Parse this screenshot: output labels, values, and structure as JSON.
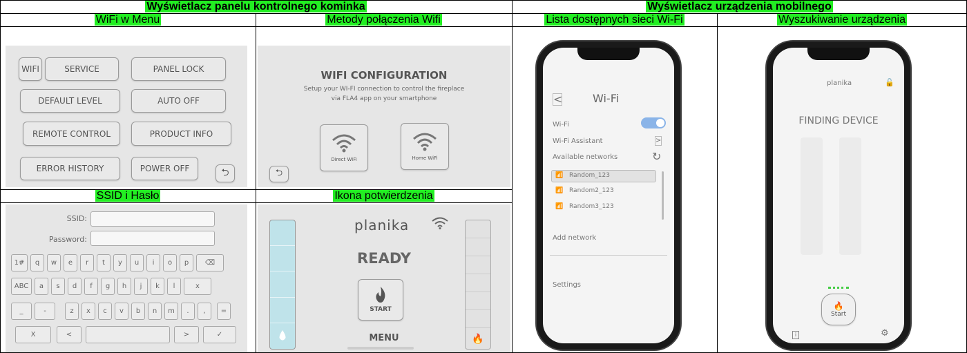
{
  "headers": {
    "left_title": "Wyświetlacz panelu kontrolnego kominka",
    "right_title": "Wyświetlacz urządzenia mobilnego",
    "wifi_menu": "WiFi w Menu",
    "methods": "Metody połączenia Wifi",
    "networks_list": "Lista dostępnych sieci Wi-Fi",
    "finding": "Wyszukiwanie urządzenia",
    "ssid_pass": "SSID i Hasło",
    "confirm_icon": "Ikona potwierdzenia"
  },
  "menu": {
    "wifi": "WIFI",
    "service": "SERVICE",
    "panel_lock": "PANEL LOCK",
    "default_level": "DEFAULT LEVEL",
    "auto_off": "AUTO OFF",
    "remote_control": "REMOTE CONTROL",
    "product_info": "PRODUCT INFO",
    "error_history": "ERROR HISTORY",
    "power_off": "POWER OFF",
    "back_icon": "return-arrow-icon"
  },
  "wifi_config": {
    "title": "WIFI CONFIGURATION",
    "line1": "Setup your WI-FI connection to control the fireplace",
    "line2": "via FLA4 app on your smartphone",
    "direct": "Direct WiFi",
    "home": "Home WiFi"
  },
  "credentials": {
    "ssid_label": "SSID:",
    "password_label": "Password:",
    "row1": [
      "1#",
      "q",
      "w",
      "e",
      "r",
      "t",
      "y",
      "u",
      "i",
      "o",
      "p",
      "⌫"
    ],
    "row2": [
      "ABC",
      "a",
      "s",
      "d",
      "f",
      "g",
      "h",
      "j",
      "k",
      "l",
      "x"
    ],
    "row3": [
      "_",
      "-",
      "z",
      "x",
      "c",
      "v",
      "b",
      "n",
      "m",
      ".",
      ",",
      "="
    ],
    "row4": [
      "X",
      "<",
      "",
      ">",
      "✓"
    ]
  },
  "ready": {
    "brand": "planika",
    "status": "READY",
    "start": "START",
    "menu": "MENU"
  },
  "phone_wifi": {
    "title": "Wi-Fi",
    "wifi_label": "Wi-Fi",
    "assistant": "Wi-Fi Assistant",
    "available": "Available networks",
    "networks": [
      "Random_123",
      "Random2_123",
      "Random3_123"
    ],
    "add_network": "Add network",
    "settings": "Settings"
  },
  "phone_finding": {
    "brand": "planika",
    "status": "FINDING DEVICE",
    "start": "Start"
  }
}
